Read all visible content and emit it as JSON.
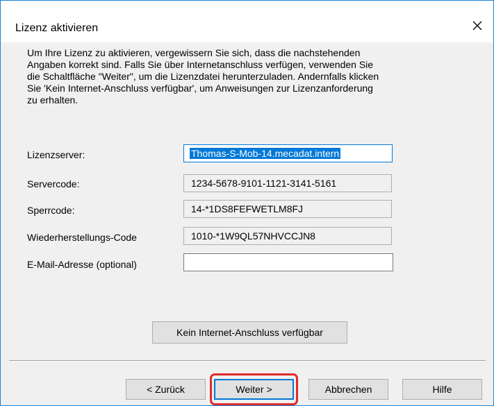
{
  "window": {
    "title": "Lizenz aktivieren",
    "close_glyph": "close-icon"
  },
  "description": {
    "lines": [
      "Um Ihre Lizenz zu aktivieren, vergewissern Sie sich, dass die nachstehenden",
      "Angaben korrekt sind. Falls Sie über Internetanschluss verfügen, verwenden Sie",
      "die Schaltfläche \"Weiter\", um die Lizenzdatei herunterzuladen. Andernfalls klicken",
      "Sie 'Kein Internet-Anschluss verfügbar', um Anweisungen zur Lizenzanforderung",
      "zu erhalten."
    ]
  },
  "fields": {
    "license_server": {
      "label": "Lizenzserver:",
      "value": "Thomas-S-Mob-14.mecadat.intern"
    },
    "server_code": {
      "label": "Servercode:",
      "value": "1234-5678-9101-1121-3141-5161"
    },
    "lock_code": {
      "label": "Sperrcode:",
      "value": "14-*1DS8FEFWETLM8FJ"
    },
    "recovery_code": {
      "label": "Wiederherstellungs-Code",
      "value": "1010-*1W9QL57NHVCCJN8"
    },
    "email": {
      "label": "E-Mail-Adresse (optional)",
      "value": ""
    }
  },
  "buttons": {
    "no_internet": "Kein Internet-Anschluss verfügbar",
    "back": "< Zurück",
    "next": "Weiter >",
    "cancel": "Abbrechen",
    "help": "Hilfe"
  },
  "colors": {
    "accent": "#0078d7",
    "highlight": "#e02a2a",
    "window_border": "#1883d7"
  }
}
